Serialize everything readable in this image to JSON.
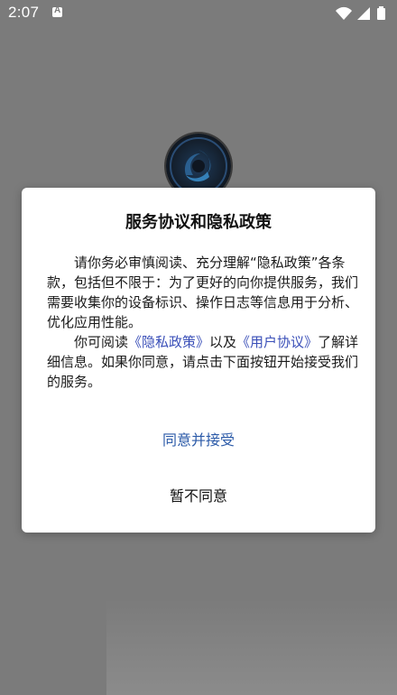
{
  "status_bar": {
    "time": "2:07"
  },
  "dialog": {
    "title": "服务协议和隐私政策",
    "paragraph1": "请你务必审慎阅读、充分理解“隐私政策”各条款，包括但不限于：为了更好的向你提供服务，我们需要收集你的设备标识、操作日志等信息用于分析、优化应用性能。",
    "paragraph2_prefix": "你可阅读",
    "privacy_link": "《隐私政策》",
    "paragraph2_middle": "以及",
    "terms_link": "《用户协议》",
    "paragraph2_suffix": "了解详细信息。如果你同意，请点击下面按钮开始接受我们的服务。",
    "agree_label": "同意并接受",
    "disagree_label": "暂不同意"
  },
  "colors": {
    "background_overlay": "#7b7b7b",
    "link": "#3a4fb8",
    "agree": "#2b5aa8"
  }
}
